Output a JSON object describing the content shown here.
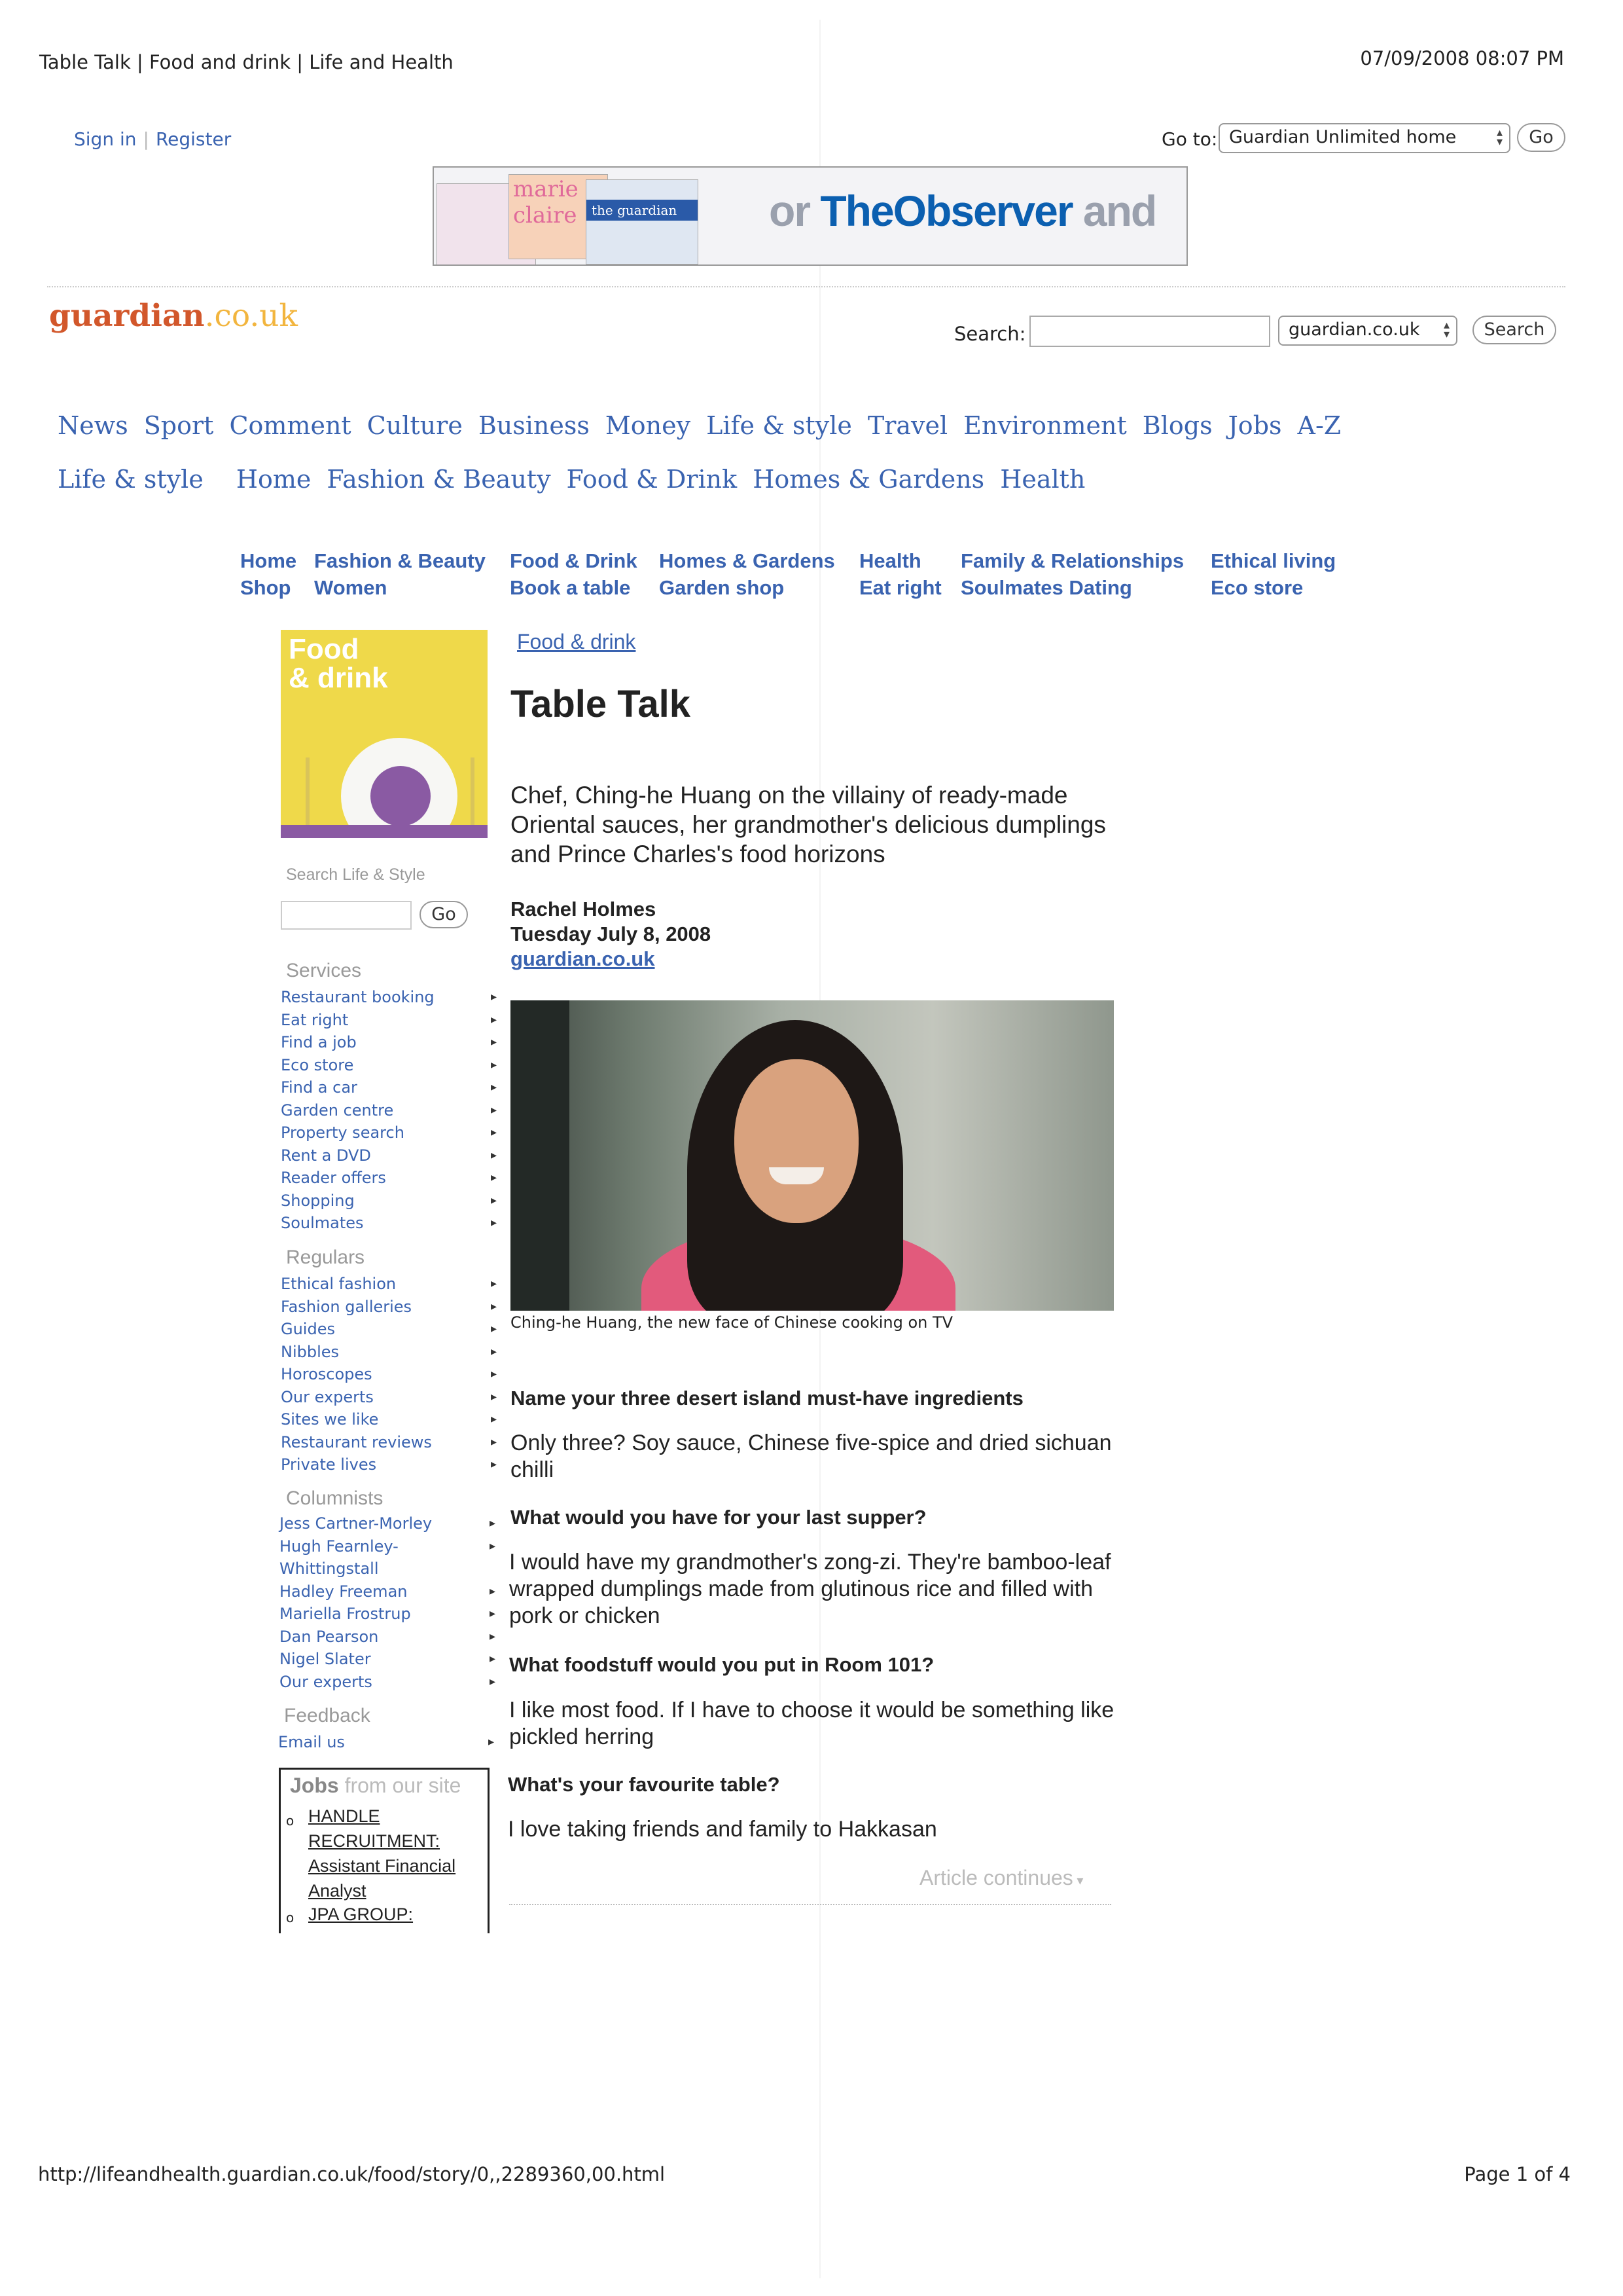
{
  "print_header": {
    "title": "Table Talk | Food and drink | Life and Health",
    "datetime": "07/09/2008 08:07 PM"
  },
  "top_bar": {
    "sign_in": "Sign in",
    "register": "Register",
    "goto_label": "Go to:",
    "goto_selected": "Guardian Unlimited home",
    "go_button": "Go"
  },
  "banner": {
    "text_prefix": "or ",
    "text_brand": "TheObserver",
    "text_suffix": " and",
    "mag_1": "marie claire",
    "mag_2": "the guardian"
  },
  "masthead": {
    "logo_main": "guardian",
    "logo_domain": ".co.uk",
    "search_label": "Search:",
    "search_value": "",
    "search_scope": "guardian.co.uk",
    "search_button": "Search"
  },
  "primary_nav": [
    "News",
    "Sport",
    "Comment",
    "Culture",
    "Business",
    "Money",
    "Life & style",
    "Travel",
    "Environment",
    "Blogs",
    "Jobs",
    "A-Z"
  ],
  "section_nav": {
    "section": "Life & style",
    "items": [
      "Home",
      "Fashion & Beauty",
      "Food & Drink",
      "Homes & Gardens",
      "Health"
    ]
  },
  "sub_nav": {
    "col1": [
      "Home",
      "Shop"
    ],
    "col2": [
      "Fashion & Beauty",
      "Women"
    ],
    "col3": [
      "Food & Drink",
      "Book a table"
    ],
    "col4": [
      "Homes & Gardens",
      "Garden shop"
    ],
    "col5": [
      "Health",
      "Eat right"
    ],
    "col6": [
      "Family & Relationships",
      "Soulmates Dating"
    ],
    "col7": [
      "Ethical living",
      "Eco store"
    ]
  },
  "sidebar": {
    "thumb_title_1": "Food",
    "thumb_title_2": "& drink",
    "search_heading": "Search Life & Style",
    "search_go": "Go",
    "services_heading": "Services",
    "services": [
      "Restaurant booking",
      "Eat right",
      "Find a job",
      "Eco store",
      "Find a car",
      "Garden centre",
      "Property search",
      "Rent a DVD",
      "Reader offers",
      "Shopping",
      "Soulmates"
    ],
    "regulars_heading": "Regulars",
    "regulars": [
      "Ethical fashion",
      "Fashion galleries",
      "Guides",
      "Nibbles",
      "Horoscopes",
      "Our experts",
      "Sites we like",
      "Restaurant reviews",
      "Private lives"
    ],
    "columnists_heading": "Columnists",
    "columnists": [
      "Jess Cartner-Morley",
      "Hugh Fearnley-",
      "Whittingstall",
      "Hadley Freeman",
      "Mariella Frostrup",
      "Dan Pearson",
      "Nigel Slater",
      "Our experts"
    ],
    "feedback_heading": "Feedback",
    "feedback_link": "Email us",
    "jobs_heading_bold": "Jobs",
    "jobs_heading_rest": " from our site",
    "jobs": [
      {
        "line1": "HANDLE",
        "line2": "RECRUITMENT:",
        "line3": "Assistant Financial",
        "line4": "Analyst"
      },
      {
        "line1": "JPA GROUP:"
      }
    ]
  },
  "article": {
    "breadcrumb": "Food & drink",
    "headline": "Table Talk",
    "standfirst": "Chef, Ching-he Huang on the villainy of ready-made Oriental sauces, her grandmother's delicious dumplings and Prince Charles's food horizons",
    "author": "Rachel Holmes",
    "date": "Tuesday July 8, 2008",
    "source": "guardian.co.uk",
    "photo_caption": "Ching-he Huang, the new face of Chinese cooking on TV",
    "qa": [
      {
        "q": "Name your three desert island must-have ingredients",
        "a": "Only three? Soy sauce, Chinese five-spice and dried sichuan chilli"
      },
      {
        "q": "What would you have for your last supper?",
        "a": "I would have my grandmother's zong-zi. They're bamboo-leaf wrapped dumplings made from glutinous rice and filled with pork or chicken"
      },
      {
        "q": "What foodstuff would you put in Room 101?",
        "a": "I like most food. If I have to choose it would be something like pickled herring"
      },
      {
        "q": "What's your favourite table?",
        "a": "I love taking friends and family to Hakkasan"
      }
    ],
    "continues": "Article continues"
  },
  "print_footer": {
    "url": "http://lifeandhealth.guardian.co.uk/food/story/0,,2289360,00.html",
    "page": "Page 1 of 4"
  }
}
